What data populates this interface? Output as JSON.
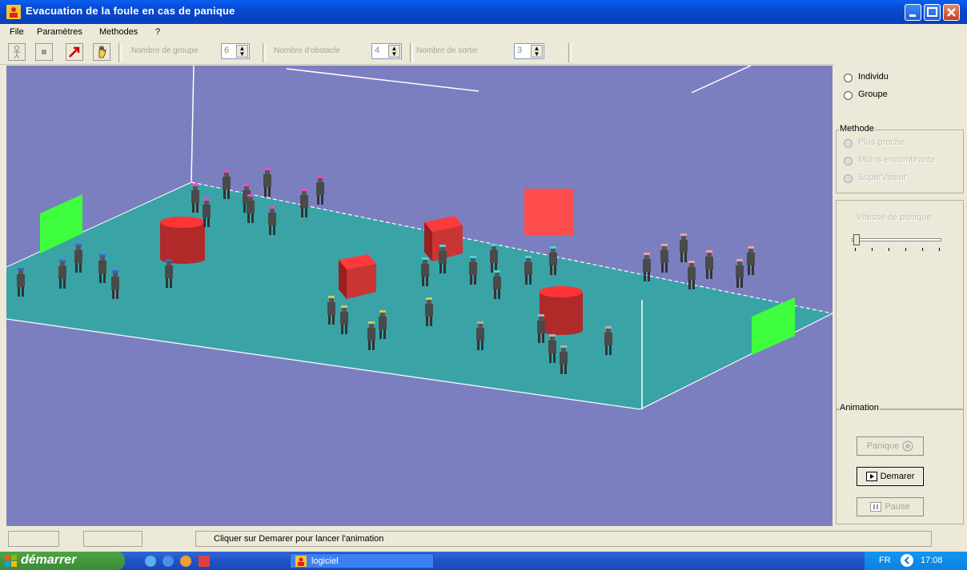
{
  "window": {
    "title": "Evacuation de la foule en cas de panique"
  },
  "menu": {
    "items": [
      "File",
      "Paramètres",
      "Methodes",
      "?"
    ]
  },
  "toolbar": {
    "groups_label": "Nombre de groupe",
    "groups_value": "6",
    "obstacles_label": "Nombre d'obstacle",
    "obstacles_value": "4",
    "exits_label": "Nombre de sortie",
    "exits_value": "3"
  },
  "panel": {
    "mode_options": [
      "Individu",
      "Groupe"
    ],
    "methode_title": "Methode",
    "methode_options": [
      "Plus proche",
      "Moins encombrante",
      "SuperViseur"
    ],
    "speed_label": "Vitesse de panique",
    "speed_level": 0,
    "animation_title": "Animation",
    "panique_button": "Panique",
    "demarer_button": "Demarer",
    "pause_button": "Pause"
  },
  "status": {
    "message": "Cliquer sur Demarer pour lancer l'animation"
  },
  "taskbar": {
    "start_label": "démarrer",
    "task_label": "logiciel",
    "language": "FR",
    "clock": "17:08"
  },
  "colors": {
    "scene_bg": "#7b7fbf",
    "floor": "#3aa3a6",
    "exit": "#3dff3d",
    "obstacle": "#e83a3a"
  }
}
